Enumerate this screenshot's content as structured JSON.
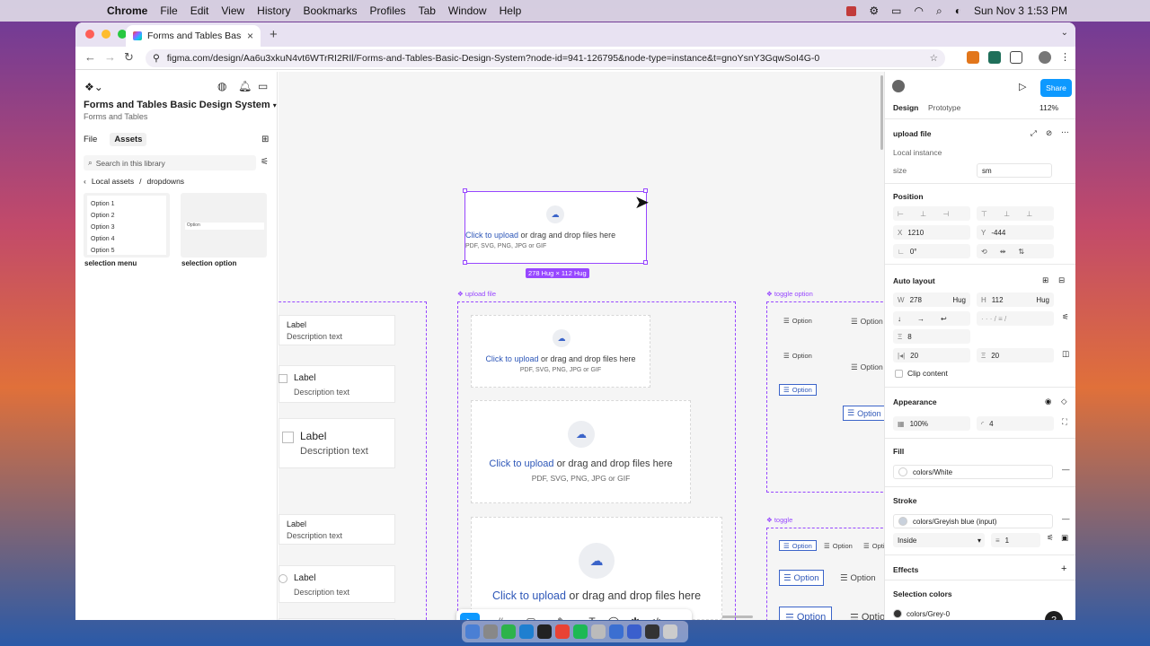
{
  "menubar": {
    "app": "Chrome",
    "items": [
      "File",
      "Edit",
      "View",
      "History",
      "Bookmarks",
      "Profiles",
      "Tab",
      "Window",
      "Help"
    ],
    "datetime": "Sun Nov 3  1:53 PM"
  },
  "browser": {
    "tab_title": "Forms and Tables Basic Desig",
    "url": "figma.com/design/Aa6u3xkuN4vt6WTrRI2RIl/Forms-and-Tables-Basic-Design-System?node-id=941-126795&node-type=instance&t=gnoYsnY3GqwSoI4G-0"
  },
  "left_panel": {
    "file_title": "Forms and Tables Basic Design System",
    "file_subtitle": "Forms and Tables",
    "tabs": [
      "File",
      "Assets"
    ],
    "search_placeholder": "Search in this library",
    "breadcrumb_root": "Local assets",
    "breadcrumb_sep": "/",
    "breadcrumb_leaf": "dropdowns",
    "thumb1_options": [
      "Option 1",
      "Option 2",
      "Option 3",
      "Option 4",
      "Option 5"
    ],
    "thumb2_text": "Option",
    "thumb1_label": "selection menu",
    "thumb2_label": "selection option"
  },
  "canvas": {
    "upload": {
      "link": "Click to upload",
      "rest": " or drag and drop files here",
      "formats": "PDF, SVG, PNG, JPG or GIF"
    },
    "size_badge": "278 Hug × 112 Hug",
    "frame_upload_label": "upload file",
    "frame_toggle_option_label": "toggle option",
    "frame_toggle_label": "toggle",
    "label": "Label",
    "description": "Description text",
    "option": "Option"
  },
  "right_panel": {
    "tabs": [
      "Design",
      "Prototype"
    ],
    "zoom": "112%",
    "share": "Share",
    "component_name": "upload file",
    "instance": "Local instance",
    "size_label": "size",
    "size_value": "sm",
    "position": "Position",
    "x_label": "X",
    "x_value": "1210",
    "y_label": "Y",
    "y_value": "-444",
    "rotation": "0°",
    "auto_layout": "Auto layout",
    "w_label": "W",
    "w_value": "278",
    "w_mode": "Hug",
    "h_label": "H",
    "h_value": "112",
    "h_mode": "Hug",
    "gap": "8",
    "padding_h": "20",
    "padding_v": "20",
    "clip": "Clip content",
    "appearance": "Appearance",
    "opacity": "100%",
    "radius": "4",
    "fill": "Fill",
    "fill_value": "colors/White",
    "stroke": "Stroke",
    "stroke_value": "colors/Greyish blue (input)",
    "stroke_position": "Inside",
    "stroke_weight": "1",
    "effects": "Effects",
    "selection_colors": "Selection colors",
    "selection_color_value": "colors/Grey-0"
  },
  "colors": {
    "accent": "#9747ff",
    "blue": "#0d99ff",
    "link": "#2e57b8"
  }
}
